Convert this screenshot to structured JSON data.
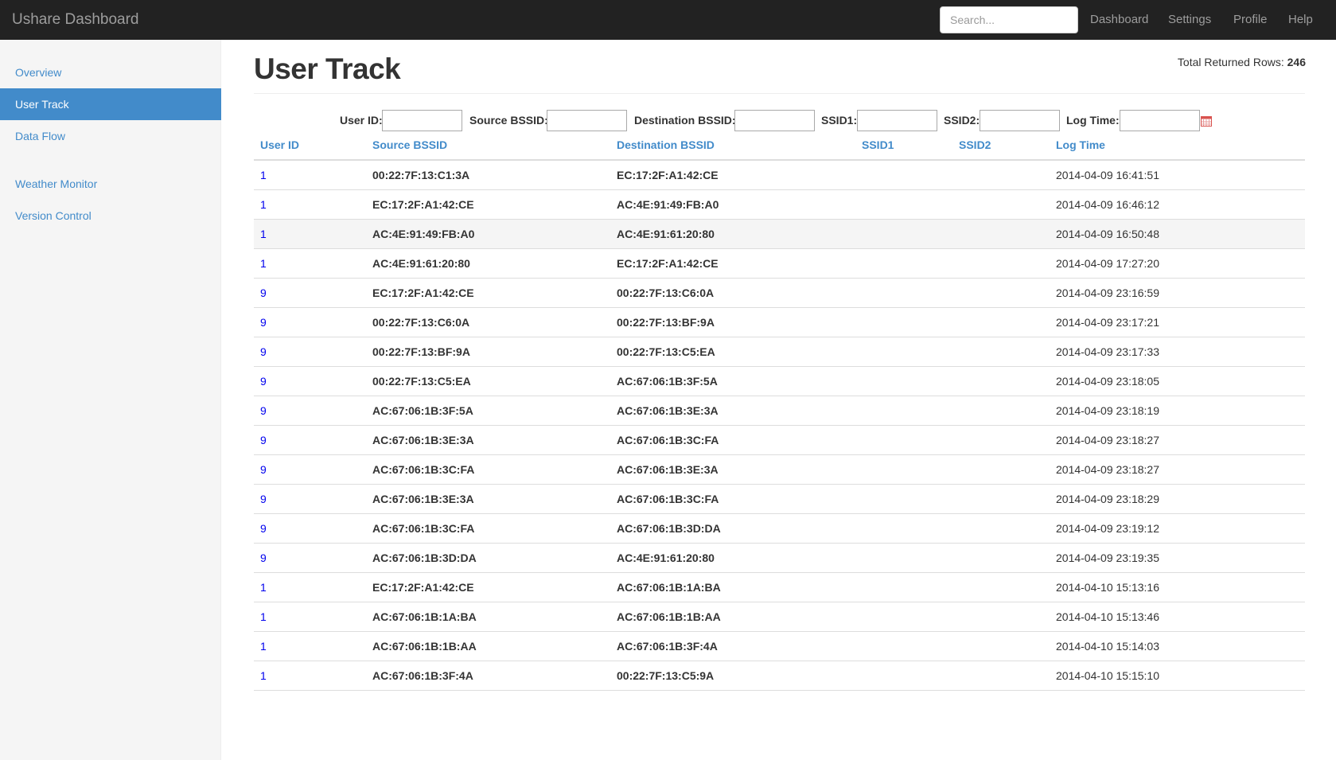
{
  "navbar": {
    "brand": "Ushare Dashboard",
    "search_placeholder": "Search...",
    "links": [
      "Dashboard",
      "Settings",
      "Profile",
      "Help"
    ]
  },
  "sidebar": {
    "items": [
      "Overview",
      "User Track",
      "Data Flow",
      "Weather Monitor",
      "Version Control"
    ],
    "active": "User Track"
  },
  "page": {
    "title": "User Track",
    "total_label": "Total Returned Rows:",
    "total_value": "246"
  },
  "filters": {
    "user_id": "User ID:",
    "source_bssid": "Source BSSID:",
    "destination_bssid": "Destination BSSID:",
    "ssid1": "SSID1:",
    "ssid2": "SSID2:",
    "log_time": "Log Time:"
  },
  "table": {
    "headers": [
      "User ID",
      "Source BSSID",
      "Destination BSSID",
      "SSID1",
      "SSID2",
      "Log Time"
    ],
    "rows": [
      [
        "1",
        "00:22:7F:13:C1:3A",
        "EC:17:2F:A1:42:CE",
        "",
        "",
        "2014-04-09 16:41:51"
      ],
      [
        "1",
        "EC:17:2F:A1:42:CE",
        "AC:4E:91:49:FB:A0",
        "",
        "",
        "2014-04-09 16:46:12"
      ],
      [
        "1",
        "AC:4E:91:49:FB:A0",
        "AC:4E:91:61:20:80",
        "",
        "",
        "2014-04-09 16:50:48"
      ],
      [
        "1",
        "AC:4E:91:61:20:80",
        "EC:17:2F:A1:42:CE",
        "",
        "",
        "2014-04-09 17:27:20"
      ],
      [
        "9",
        "EC:17:2F:A1:42:CE",
        "00:22:7F:13:C6:0A",
        "",
        "",
        "2014-04-09 23:16:59"
      ],
      [
        "9",
        "00:22:7F:13:C6:0A",
        "00:22:7F:13:BF:9A",
        "",
        "",
        "2014-04-09 23:17:21"
      ],
      [
        "9",
        "00:22:7F:13:BF:9A",
        "00:22:7F:13:C5:EA",
        "",
        "",
        "2014-04-09 23:17:33"
      ],
      [
        "9",
        "00:22:7F:13:C5:EA",
        "AC:67:06:1B:3F:5A",
        "",
        "",
        "2014-04-09 23:18:05"
      ],
      [
        "9",
        "AC:67:06:1B:3F:5A",
        "AC:67:06:1B:3E:3A",
        "",
        "",
        "2014-04-09 23:18:19"
      ],
      [
        "9",
        "AC:67:06:1B:3E:3A",
        "AC:67:06:1B:3C:FA",
        "",
        "",
        "2014-04-09 23:18:27"
      ],
      [
        "9",
        "AC:67:06:1B:3C:FA",
        "AC:67:06:1B:3E:3A",
        "",
        "",
        "2014-04-09 23:18:27"
      ],
      [
        "9",
        "AC:67:06:1B:3E:3A",
        "AC:67:06:1B:3C:FA",
        "",
        "",
        "2014-04-09 23:18:29"
      ],
      [
        "9",
        "AC:67:06:1B:3C:FA",
        "AC:67:06:1B:3D:DA",
        "",
        "",
        "2014-04-09 23:19:12"
      ],
      [
        "9",
        "AC:67:06:1B:3D:DA",
        "AC:4E:91:61:20:80",
        "",
        "",
        "2014-04-09 23:19:35"
      ],
      [
        "1",
        "EC:17:2F:A1:42:CE",
        "AC:67:06:1B:1A:BA",
        "",
        "",
        "2014-04-10 15:13:16"
      ],
      [
        "1",
        "AC:67:06:1B:1A:BA",
        "AC:67:06:1B:1B:AA",
        "",
        "",
        "2014-04-10 15:13:46"
      ],
      [
        "1",
        "AC:67:06:1B:1B:AA",
        "AC:67:06:1B:3F:4A",
        "",
        "",
        "2014-04-10 15:14:03"
      ],
      [
        "1",
        "AC:67:06:1B:3F:4A",
        "00:22:7F:13:C5:9A",
        "",
        "",
        "2014-04-10 15:15:10"
      ]
    ],
    "highlighted_row": 2
  },
  "colors": {
    "navbar_bg": "#222222",
    "accent": "#428bca",
    "link": "#0000ee",
    "sidebar_bg": "#f5f5f5"
  },
  "icons": {
    "log_time_picker": "calendar-icon"
  }
}
